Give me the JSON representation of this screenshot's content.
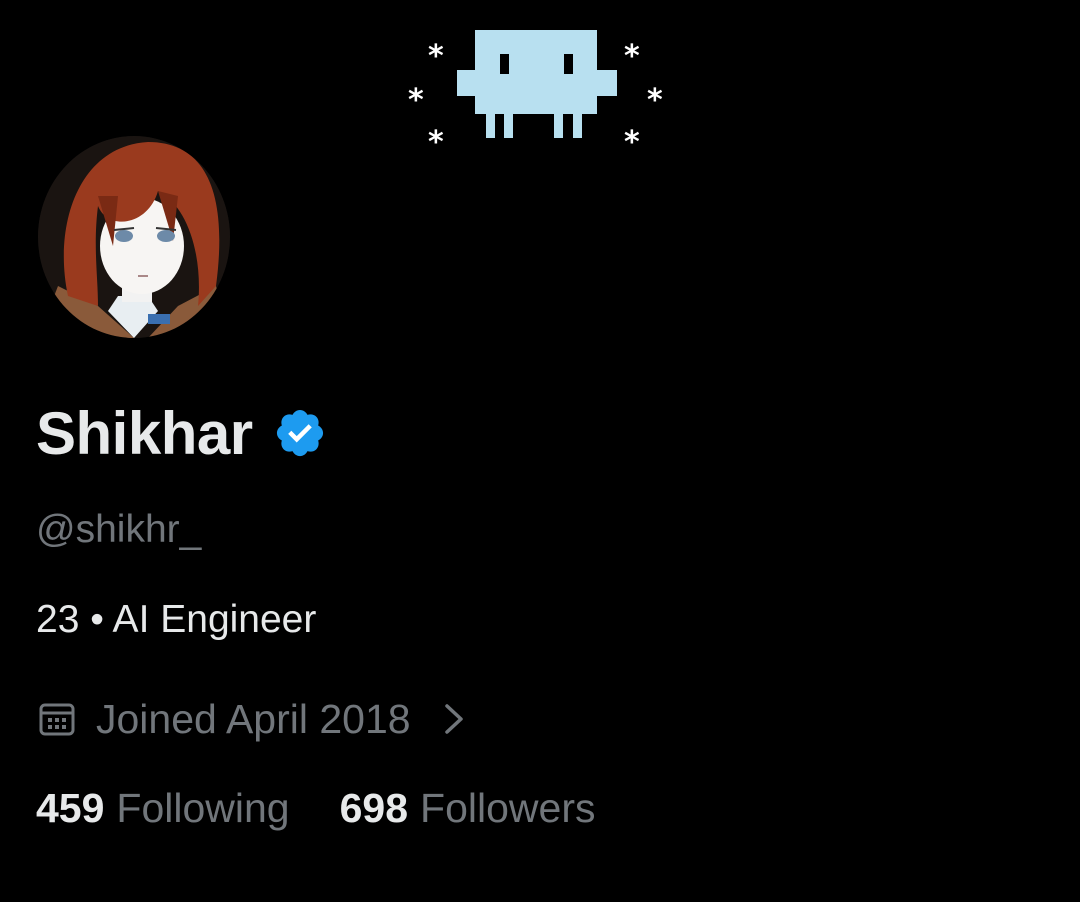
{
  "profile": {
    "display_name": "Shikhar",
    "verified": true,
    "handle": "@shikhr_",
    "bio": "23 • AI Engineer",
    "joined": "Joined April 2018",
    "stats": {
      "following_count": "459",
      "following_label": "Following",
      "followers_count": "698",
      "followers_label": "Followers"
    }
  },
  "icons": {
    "verified": "verified-badge-icon",
    "calendar": "calendar-icon",
    "chevron": "chevron-right-icon",
    "banner": "pixel-invader-icon"
  },
  "colors": {
    "background": "#000000",
    "primary_text": "#e7e9ea",
    "secondary_text": "#71767b",
    "verified_blue": "#1d9bf0",
    "banner_invader": "#b8e0f0"
  }
}
